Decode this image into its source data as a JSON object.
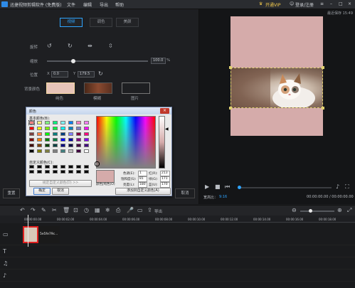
{
  "app": {
    "title": "迅捷视频剪辑软件 (免费版)",
    "menu": [
      "文件",
      "编辑",
      "导出",
      "帮助"
    ],
    "vip_label": "开通VIP",
    "login_label": "登录/注册",
    "last_saved": "最近保存 15:49"
  },
  "editor": {
    "tabs": [
      "视频",
      "调色",
      "美颜"
    ],
    "rotate_label": "旋转",
    "scale_label": "缩放",
    "scale_value": "100.0",
    "scale_unit": "%",
    "position_label": "位置",
    "pos_x_label": "X",
    "pos_x_value": "0.0",
    "pos_y_label": "Y",
    "pos_y_value": "179.5",
    "bg_color_label": "背景颜色",
    "bg_options": [
      "纯色",
      "模糊",
      "图片"
    ],
    "reset_label": "重置",
    "cancel_label": "取消"
  },
  "color_dialog": {
    "title": "颜色",
    "basic_colors_label": "基本颜色(B):",
    "custom_colors_label": "自定义颜色(C):",
    "define_custom_label": "规定自定义颜色(D) >>",
    "ok_label": "确定",
    "cancel_label": "取消",
    "solid_label": "颜色|纯色(O)",
    "add_custom_label": "添加到自定义颜色(A)",
    "hue_label": "色调(E):",
    "hue": "1",
    "sat_label": "饱和度(S):",
    "sat": "81",
    "lum_label": "亮度(L):",
    "lum": "180",
    "red_label": "红(R):",
    "red": "213",
    "green_label": "绿(G):",
    "green": "171",
    "blue_label": "蓝(U):",
    "blue": "170",
    "selected_color": "#d5abaa",
    "basic_colors": [
      "#ff8080",
      "#ffff80",
      "#80ff80",
      "#00ff80",
      "#80ffff",
      "#0080ff",
      "#ff80c0",
      "#ff80ff",
      "#ff0000",
      "#ffff00",
      "#80ff00",
      "#00ff40",
      "#00ffff",
      "#0080c0",
      "#8080c0",
      "#ff00ff",
      "#804040",
      "#ff8040",
      "#00ff00",
      "#008080",
      "#004080",
      "#8080ff",
      "#800040",
      "#ff0080",
      "#800000",
      "#ff8000",
      "#008000",
      "#008040",
      "#0000ff",
      "#0000a0",
      "#800080",
      "#8000ff",
      "#400000",
      "#804000",
      "#004000",
      "#004040",
      "#000080",
      "#000040",
      "#400040",
      "#400080",
      "#000000",
      "#808000",
      "#808040",
      "#808080",
      "#408080",
      "#c0c0c0",
      "#400040",
      "#ffffff"
    ]
  },
  "preview": {
    "total_label": "宽高比：",
    "ratio": "9:16",
    "time": "00:00:00.00 / 00:00:00.00",
    "bg_color": "#d5abaa"
  },
  "timeline": {
    "export_label": "导出",
    "clip_label": "5e5fe79c...",
    "ruler_ticks": [
      "00:00:00.00",
      "00:00:02.00",
      "00:00:04.00",
      "00:00:06.00",
      "00:00:08.00",
      "00:00:10.00",
      "00:00:12.00",
      "00:00:14.00",
      "00:00:16.00",
      "00:00:18.00",
      "00:00:20.00"
    ]
  }
}
